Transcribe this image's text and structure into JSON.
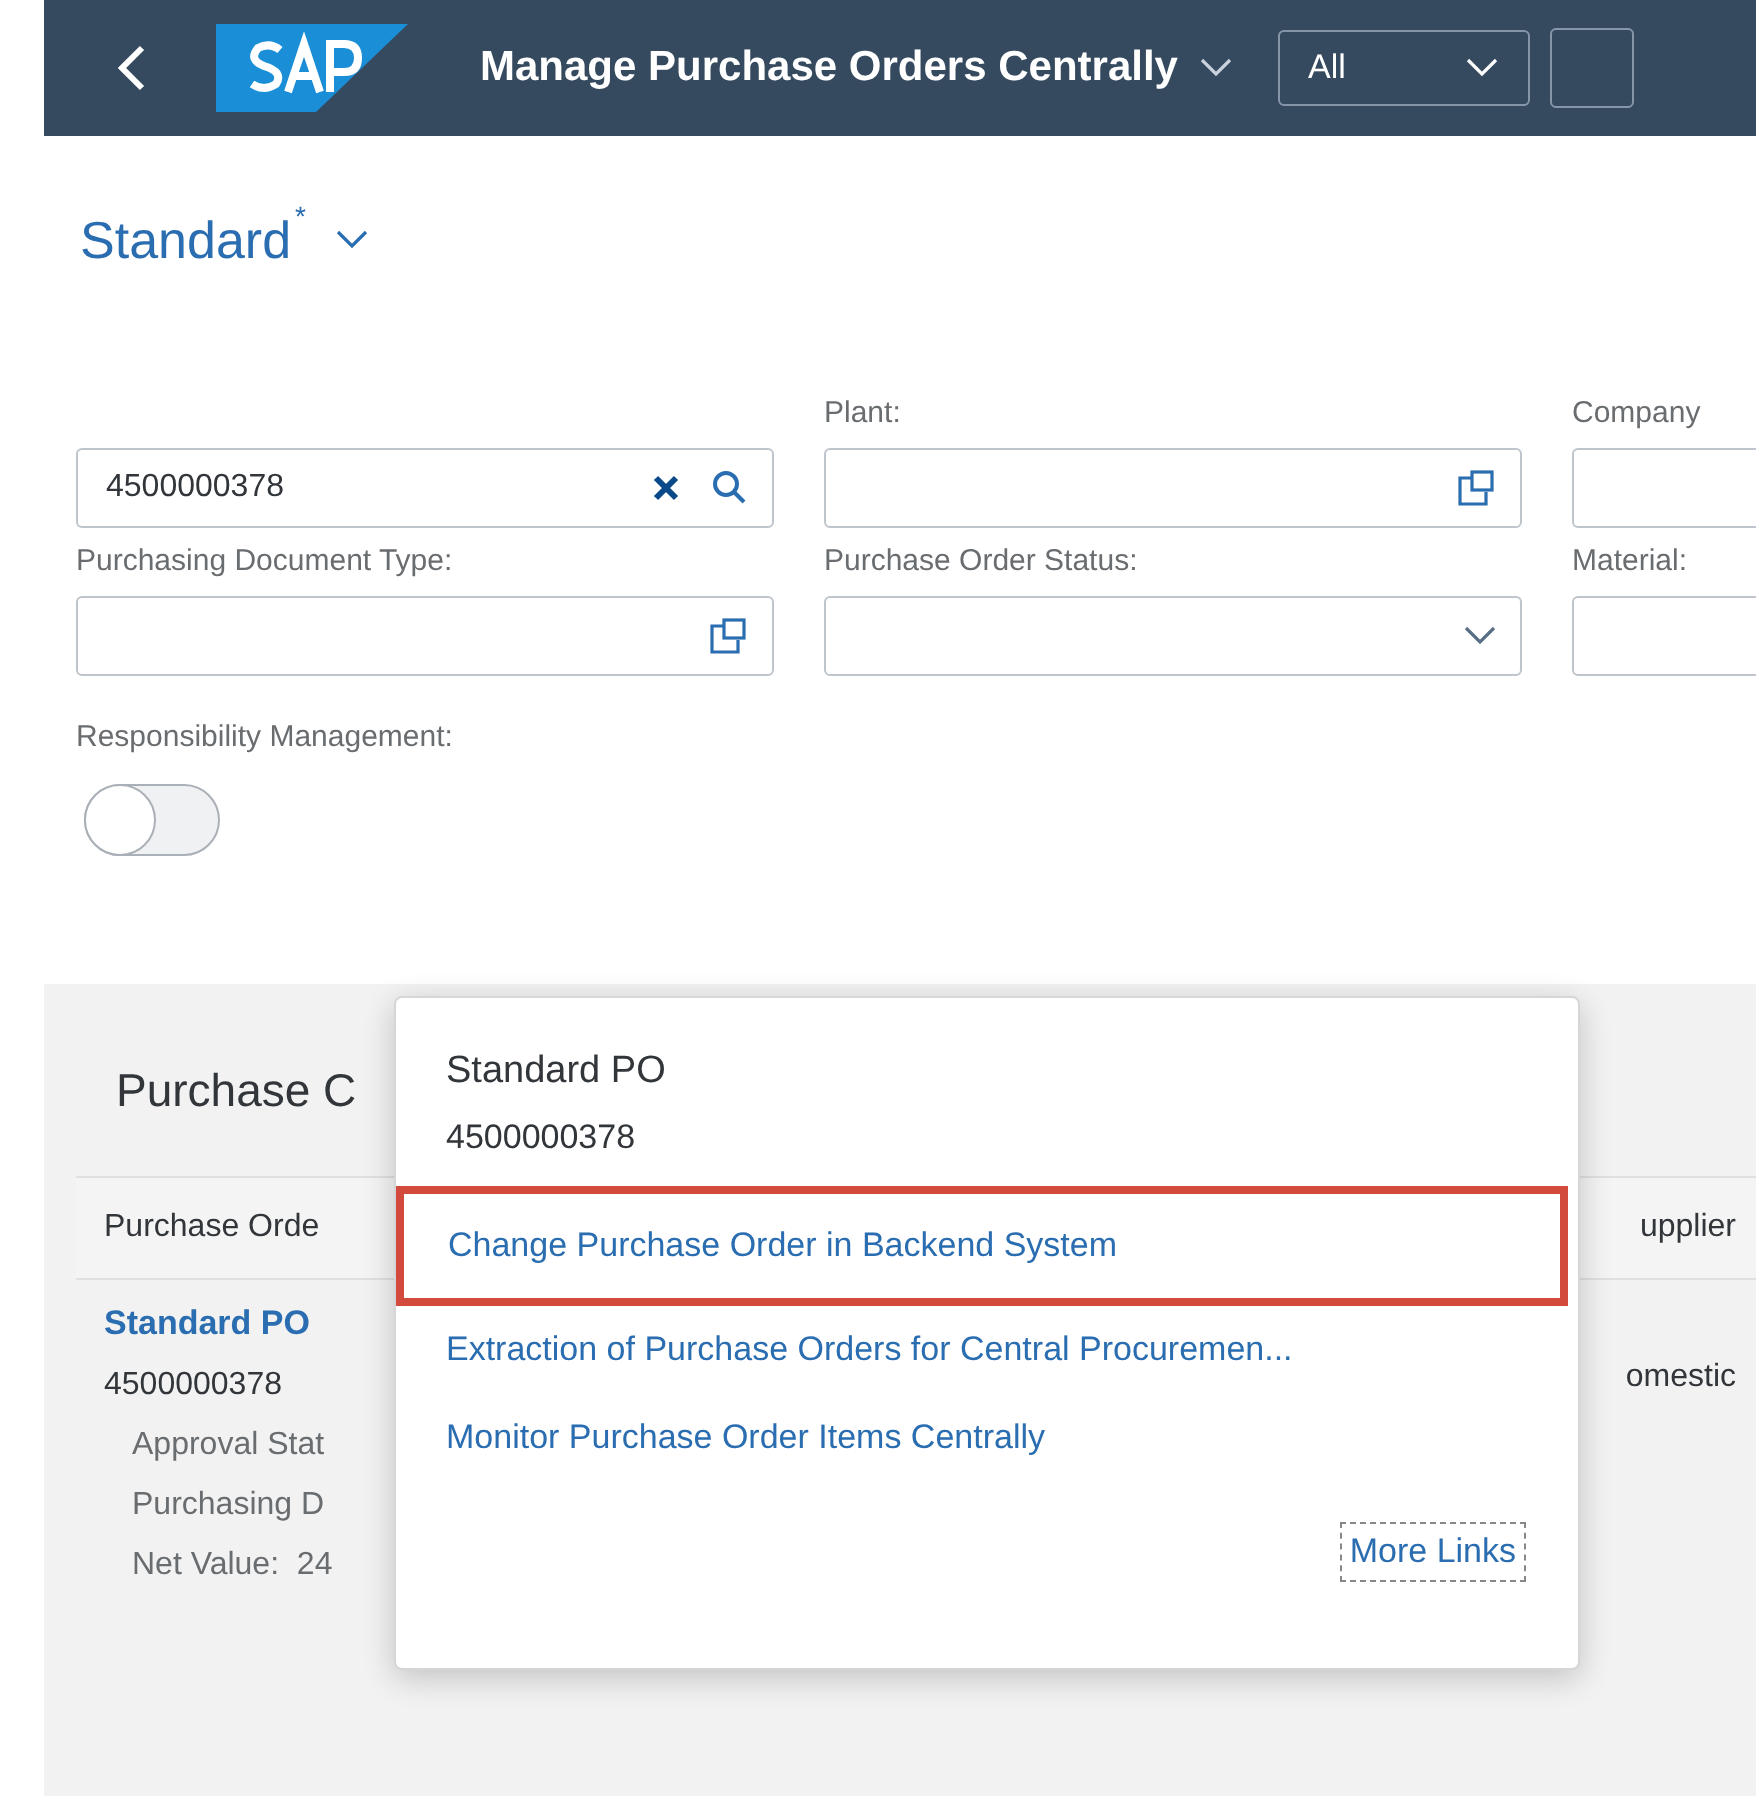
{
  "shell": {
    "title": "Manage Purchase Orders Centrally",
    "scope_select": {
      "value": "All"
    }
  },
  "variant": {
    "name": "Standard",
    "modified_mark": "*"
  },
  "filters": [
    {
      "value": "4500000378",
      "kind": "search"
    },
    {
      "label": "Plant:",
      "kind": "valuehelp"
    },
    {
      "label": "Company",
      "kind": "plain"
    },
    {
      "label": "Purchasing Document Type:",
      "kind": "valuehelp"
    },
    {
      "label": "Purchase Order Status:",
      "kind": "dropdown"
    },
    {
      "label": "Material:",
      "kind": "plain"
    }
  ],
  "responsibility": {
    "label": "Responsibility Management:",
    "on": false
  },
  "table": {
    "title": "Purchase C",
    "columns": [
      "Purchase Orde",
      "upplier"
    ],
    "row": {
      "link": "Standard PO",
      "number": "4500000378",
      "details": [
        "Approval Stat",
        "Purchasing D",
        "Net Value:  24"
      ],
      "supplier": "omestic"
    }
  },
  "popover": {
    "title": "Standard PO",
    "subtitle": "4500000378",
    "links": [
      {
        "label": "Change Purchase Order in Backend System",
        "highlighted": true
      },
      {
        "label": "Extraction of Purchase Orders for Central Procuremen...",
        "highlighted": false
      },
      {
        "label": "Monitor Purchase Order Items Centrally",
        "highlighted": false
      }
    ],
    "more": "More Links"
  }
}
